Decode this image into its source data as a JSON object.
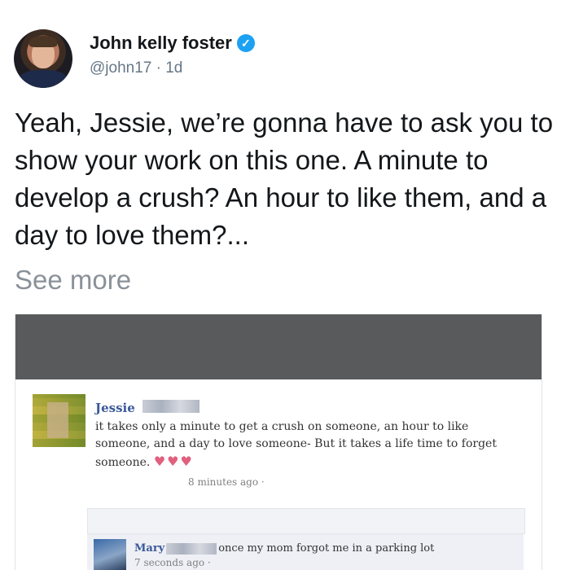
{
  "author": {
    "name": "John kelly foster",
    "handle_time": "@john17 · 1d"
  },
  "tweet": {
    "text": "Yeah, Jessie, we’re gonna have to ask you to show your work on this one. A minute to develop a crush? An hour to like them, and a day to love them?...",
    "see_more": "See more"
  },
  "screenshot": {
    "post": {
      "name": "Jessie",
      "text": "it takes only a minute to get a crush on someone, an hour to like someone, and a day to love someone- But it takes a life time to forget someone.",
      "hearts": "♥♥♥",
      "time": "8 minutes ago ·"
    },
    "comment": {
      "name": "Mary",
      "text": "once my mom forgot me in a parking lot",
      "time": "7 seconds ago ·"
    }
  },
  "icons": {
    "verified": "verified-badge-icon"
  },
  "colors": {
    "verified": "#1da1f2",
    "link_name": "#3b5998",
    "muted": "#657786"
  }
}
